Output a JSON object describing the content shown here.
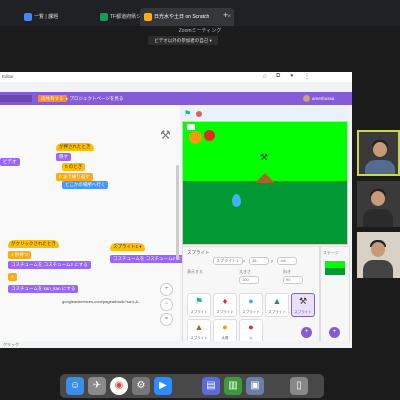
{
  "browser": {
    "tabs": [
      {
        "label": "一覧 | 課題",
        "active": false
      },
      {
        "label": "TF都道府県シート - Google スプ",
        "active": false
      },
      {
        "label": "日光水や土日 on Scratch",
        "active": true
      }
    ],
    "new_tab": "+"
  },
  "zoom": {
    "title": "Zoomミーティング",
    "share_label": "ビデオ以外の参加者の自己 ▾"
  },
  "url": {
    "text": "Editor"
  },
  "scratch": {
    "menu": {
      "save_label": "再共有する",
      "project_page": "プロジェクトページを見る",
      "username": "amerbossa"
    },
    "blocks": [
      {
        "text": "ビデオ",
        "cat": "looks"
      },
      {
        "text": "が押されたとき",
        "cat": "events"
      },
      {
        "text": "隠す",
        "cat": "looks"
      },
      {
        "text": "0 のとき",
        "cat": "events"
      },
      {
        "text": "0 まで繰り返す",
        "cat": "control"
      },
      {
        "text": "どこかの場所へ行く",
        "cat": "motion"
      },
      {
        "text": "がクリックされたとき",
        "cat": "events"
      },
      {
        "text": "1 秒待つ",
        "cat": "control"
      },
      {
        "text": "コスチュームを  コスチューム2  にする",
        "cat": "looks"
      },
      {
        "text": "1",
        "cat": "control"
      },
      {
        "text": "コスチュームを  kan_kan  にする",
        "cat": "looks"
      },
      {
        "text": "スプライト1 ▾",
        "cat": "events"
      },
      {
        "text": "コスチュームを  コスチューム2  にする",
        "cat": "looks"
      }
    ],
    "float_url": "googleadservices.com/pagead/aclk?sa=L&...",
    "zoom_in": "+",
    "zoom_out": "−",
    "zoom_reset": "=",
    "stage_label": "ステージ",
    "sprite_pane": {
      "title": "スプライト",
      "name_value": "スプライト1",
      "x_label": "x",
      "x_value": "36",
      "y_label": "y",
      "y_value": "-64",
      "show_label": "表示する",
      "size_label": "大きさ",
      "size_value": "100",
      "dir_label": "向き",
      "dir_value": "90"
    },
    "sprites": [
      {
        "name": "スプライト",
        "icon": "flag-icon"
      },
      {
        "name": "スプライト",
        "icon": "fire-icon"
      },
      {
        "name": "スプライト",
        "icon": "drop-icon"
      },
      {
        "name": "スプライト",
        "icon": "tree-icon"
      },
      {
        "name": "スプライト",
        "icon": "hammer-icon"
      },
      {
        "name": "スプライト",
        "icon": "hill-icon"
      },
      {
        "name": "太陽",
        "icon": "sun-icon"
      },
      {
        "name": "火",
        "icon": "apple-icon"
      }
    ],
    "status_text": "クリック"
  },
  "colors": {
    "scratch_purple": "#855cd6",
    "save_orange": "#ff8c1a",
    "sky": "#00ff00",
    "grass": "#009933"
  }
}
